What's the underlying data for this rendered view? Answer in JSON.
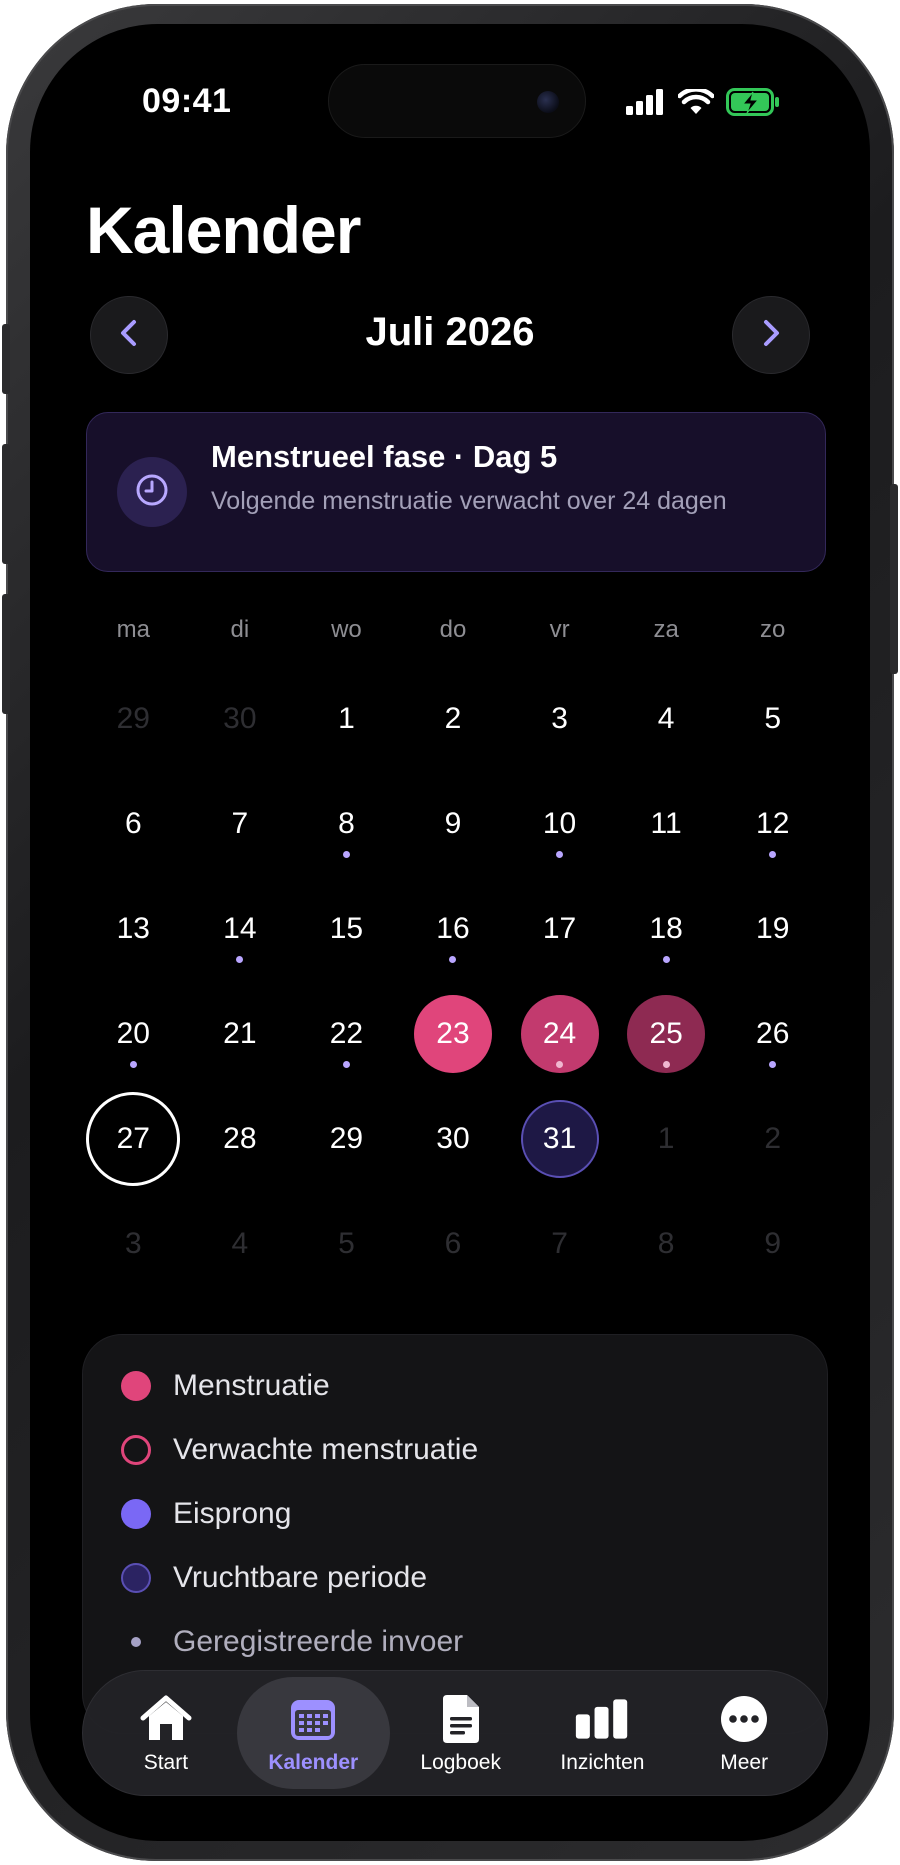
{
  "status_bar": {
    "time": "09:41"
  },
  "page": {
    "title": "Kalender"
  },
  "month_nav": {
    "title": "Juli 2026",
    "prev_icon": "chevron-left-icon",
    "next_icon": "chevron-right-icon"
  },
  "phase_card": {
    "icon": "clock-icon",
    "title": "Menstrueel fase · Dag 5",
    "subtitle": "Volgende menstruatie verwacht over 24 dagen"
  },
  "weekdays": [
    "ma",
    "di",
    "wo",
    "do",
    "vr",
    "za",
    "zo"
  ],
  "calendar": {
    "weeks": [
      [
        {
          "day": "29",
          "outside": true
        },
        {
          "day": "30",
          "outside": true
        },
        {
          "day": "1"
        },
        {
          "day": "2"
        },
        {
          "day": "3"
        },
        {
          "day": "4"
        },
        {
          "day": "5"
        }
      ],
      [
        {
          "day": "6"
        },
        {
          "day": "7"
        },
        {
          "day": "8",
          "logged": true
        },
        {
          "day": "9"
        },
        {
          "day": "10",
          "logged": true
        },
        {
          "day": "11"
        },
        {
          "day": "12",
          "logged": true
        }
      ],
      [
        {
          "day": "13"
        },
        {
          "day": "14",
          "logged": true
        },
        {
          "day": "15"
        },
        {
          "day": "16",
          "logged": true
        },
        {
          "day": "17"
        },
        {
          "day": "18",
          "logged": true
        },
        {
          "day": "19"
        }
      ],
      [
        {
          "day": "20",
          "logged": true
        },
        {
          "day": "21"
        },
        {
          "day": "22",
          "logged": true
        },
        {
          "day": "23",
          "state": "period"
        },
        {
          "day": "24",
          "state": "period-mid",
          "logged": true
        },
        {
          "day": "25",
          "state": "period-late",
          "logged": true
        },
        {
          "day": "26",
          "logged": true
        }
      ],
      [
        {
          "day": "27",
          "state": "today"
        },
        {
          "day": "28"
        },
        {
          "day": "29"
        },
        {
          "day": "30"
        },
        {
          "day": "31",
          "state": "fertile"
        },
        {
          "day": "1",
          "outside": true
        },
        {
          "day": "2",
          "outside": true
        }
      ],
      [
        {
          "day": "3",
          "outside": true
        },
        {
          "day": "4",
          "outside": true
        },
        {
          "day": "5",
          "outside": true
        },
        {
          "day": "6",
          "outside": true
        },
        {
          "day": "7",
          "outside": true
        },
        {
          "day": "8",
          "outside": true
        },
        {
          "day": "9",
          "outside": true
        }
      ]
    ]
  },
  "legend": {
    "items": [
      {
        "label": "Menstruatie",
        "swatch": "period"
      },
      {
        "label": "Verwachte menstruatie",
        "swatch": "expected"
      },
      {
        "label": "Eisprong",
        "swatch": "ovulation"
      },
      {
        "label": "Vruchtbare periode",
        "swatch": "fertile"
      },
      {
        "label": "Geregistreerde invoer",
        "swatch": "logged"
      }
    ]
  },
  "tab_bar": {
    "tabs": [
      {
        "label": "Start",
        "icon": "home-icon",
        "active": false
      },
      {
        "label": "Kalender",
        "icon": "calendar-icon",
        "active": true
      },
      {
        "label": "Logboek",
        "icon": "document-icon",
        "active": false
      },
      {
        "label": "Inzichten",
        "icon": "bar-chart-icon",
        "active": false
      },
      {
        "label": "Meer",
        "icon": "more-icon",
        "active": false
      }
    ]
  },
  "colors": {
    "period": "#e0457b",
    "ovulation": "#7a68f5",
    "fertile": "#5a4fb4",
    "accent": "#9d90ff",
    "background": "#000000"
  }
}
